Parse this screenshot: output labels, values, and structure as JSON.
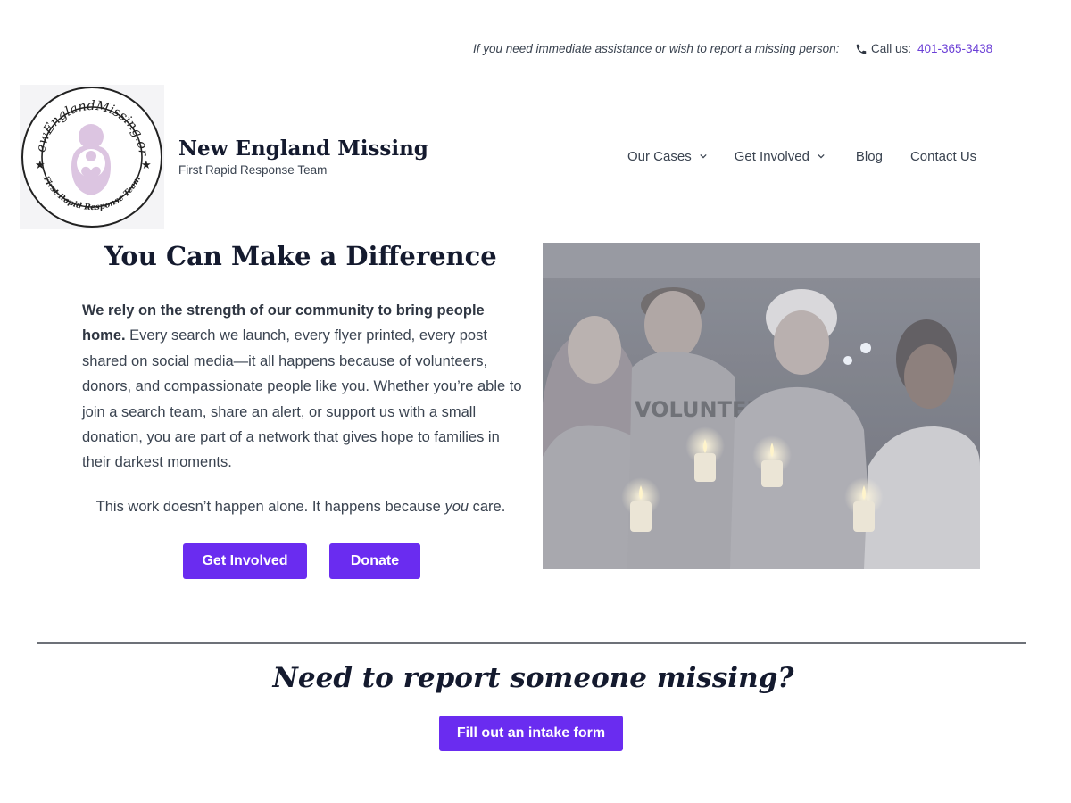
{
  "topbar": {
    "notice": "If you need immediate assistance or wish to report a missing person:",
    "call_label": "Call us:",
    "phone": "401-365-3438"
  },
  "logo": {
    "ring_text_top": "NewEnglandMissing.org",
    "ring_text_bottom": "First Rapid Response Team",
    "icon": "mother-child-heart-icon"
  },
  "brand": {
    "title": "New England Missing",
    "subtitle": "First Rapid Response Team"
  },
  "nav": {
    "items": [
      {
        "label": "Our Cases",
        "has_dropdown": true
      },
      {
        "label": "Get Involved",
        "has_dropdown": true
      },
      {
        "label": "Blog",
        "has_dropdown": false
      },
      {
        "label": "Contact Us",
        "has_dropdown": false
      }
    ]
  },
  "hero": {
    "title": "You Can Make a Difference",
    "lead_bold": "We rely on the strength of our community to bring people home.",
    "lead_rest": " Every search we launch, every flyer printed, every post shared on social media—it all happens because of volunteers, donors, and compassionate people like you. Whether you’re able to join a search team, share an alert, or support us with a small donation, you are part of a network that gives hope to families in their darkest moments.",
    "tagline_pre": "This work doesn’t happen alone. It happens because ",
    "tagline_em": "you",
    "tagline_post": " care.",
    "btn_involved": "Get Involved",
    "btn_donate": "Donate",
    "image_shirt_text": "VOLUNTEER"
  },
  "cta": {
    "title": "Need to report someone missing?",
    "button": "Fill out an intake form"
  },
  "colors": {
    "accent": "#6a2cf0",
    "link": "#6b3fd6",
    "heading": "#141a2e",
    "body": "#3a4350",
    "logo_pink": "#d9c4e0"
  }
}
